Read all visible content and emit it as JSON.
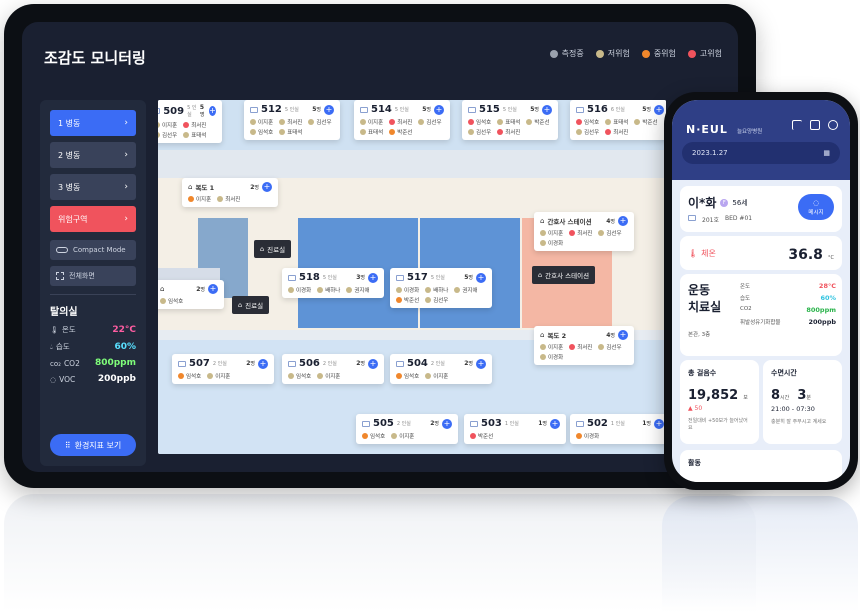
{
  "app": {
    "title": "조감도 모니터링"
  },
  "legend": [
    {
      "label": "측정중",
      "color": "#9aa1ad"
    },
    {
      "label": "저위험",
      "color": "#c8b98a"
    },
    {
      "label": "중위험",
      "color": "#f0872c"
    },
    {
      "label": "고위험",
      "color": "#f0535d"
    }
  ],
  "sidebar": {
    "wards": [
      {
        "label": "1 병동",
        "chev": "›"
      },
      {
        "label": "2 병동",
        "chev": "›"
      },
      {
        "label": "3 병동",
        "chev": "›"
      },
      {
        "label": "위험구역",
        "chev": "›"
      }
    ],
    "compact_label": "Compact Mode",
    "fullscreen_label": "전체화면",
    "room_name": "탈의실",
    "env": [
      {
        "label": "온도",
        "value": "22°C",
        "color": "#ff5da2"
      },
      {
        "label": "습도",
        "value": "60%",
        "color": "#59e0ff"
      },
      {
        "label": "CO2",
        "value": "800ppm",
        "color": "#7fff7a"
      },
      {
        "label": "VOC",
        "value": "200ppb",
        "color": "#ffffff"
      }
    ],
    "env_button": "환경지표 보기"
  },
  "floor": {
    "rooms": [
      {
        "num": "509",
        "beds": "5 인실",
        "count": "5",
        "patients": [
          {
            "name": "이지훈",
            "color": "#c8b98a"
          },
          {
            "name": "최서진",
            "color": "#f0535d"
          },
          {
            "name": "김선우",
            "color": "#c8b98a"
          },
          {
            "name": "표태석",
            "color": "#c8b98a"
          }
        ]
      },
      {
        "num": "512",
        "beds": "5 인실",
        "count": "5",
        "patients": [
          {
            "name": "이지훈",
            "color": "#c8b98a"
          },
          {
            "name": "최서진",
            "color": "#c8b98a"
          },
          {
            "name": "김선우",
            "color": "#c8b98a"
          },
          {
            "name": "임석호",
            "color": "#c8b98a"
          },
          {
            "name": "표태석",
            "color": "#c8b98a"
          }
        ]
      },
      {
        "num": "514",
        "beds": "5 인실",
        "count": "5",
        "patients": [
          {
            "name": "이지훈",
            "color": "#c8b98a"
          },
          {
            "name": "최서진",
            "color": "#f0535d"
          },
          {
            "name": "김선우",
            "color": "#c8b98a"
          },
          {
            "name": "표태석",
            "color": "#c8b98a"
          },
          {
            "name": "박준선",
            "color": "#f0872c"
          }
        ]
      },
      {
        "num": "515",
        "beds": "5 인실",
        "count": "5",
        "patients": [
          {
            "name": "임석호",
            "color": "#f0535d"
          },
          {
            "name": "표태석",
            "color": "#c8b98a"
          },
          {
            "name": "박준선",
            "color": "#c8b98a"
          },
          {
            "name": "김선우",
            "color": "#c8b98a"
          },
          {
            "name": "최서진",
            "color": "#f0535d"
          }
        ]
      },
      {
        "num": "516",
        "beds": "6 인실",
        "count": "5",
        "patients": [
          {
            "name": "임석호",
            "color": "#f0535d"
          },
          {
            "name": "표태석",
            "color": "#c8b98a"
          },
          {
            "name": "박준선",
            "color": "#c8b98a"
          },
          {
            "name": "김선우",
            "color": "#c8b98a"
          },
          {
            "name": "최서진",
            "color": "#f0535d"
          }
        ]
      },
      {
        "num": "518",
        "beds": "5 인실",
        "count": "3",
        "patients": [
          {
            "name": "이경화",
            "color": "#c8b98a"
          },
          {
            "name": "배하나",
            "color": "#c8b98a"
          },
          {
            "name": "권지애",
            "color": "#c8b98a"
          }
        ]
      },
      {
        "num": "517",
        "beds": "5 인실",
        "count": "5",
        "patients": [
          {
            "name": "이경화",
            "color": "#c8b98a"
          },
          {
            "name": "배하나",
            "color": "#c8b98a"
          },
          {
            "name": "권지애",
            "color": "#c8b98a"
          },
          {
            "name": "박준선",
            "color": "#f0872c"
          },
          {
            "name": "김선우",
            "color": "#c8b98a"
          }
        ]
      },
      {
        "num": "507",
        "beds": "2 인실",
        "count": "2",
        "patients": [
          {
            "name": "임석호",
            "color": "#f0872c"
          },
          {
            "name": "이지훈",
            "color": "#c8b98a"
          }
        ]
      },
      {
        "num": "506",
        "beds": "2 인실",
        "count": "2",
        "patients": [
          {
            "name": "임석호",
            "color": "#c8b98a"
          },
          {
            "name": "이지훈",
            "color": "#c8b98a"
          }
        ]
      },
      {
        "num": "504",
        "beds": "2 인실",
        "count": "2",
        "patients": [
          {
            "name": "임석호",
            "color": "#f0872c"
          },
          {
            "name": "이지훈",
            "color": "#c8b98a"
          }
        ]
      },
      {
        "num": "505",
        "beds": "2 인실",
        "count": "2",
        "patients": [
          {
            "name": "임석호",
            "color": "#f0872c"
          },
          {
            "name": "이지훈",
            "color": "#c8b98a"
          }
        ]
      },
      {
        "num": "503",
        "beds": "1 인실",
        "count": "1",
        "patients": [
          {
            "name": "박준선",
            "color": "#f0535d"
          }
        ]
      },
      {
        "num": "502",
        "beds": "1 인실",
        "count": "1",
        "patients": [
          {
            "name": "이경화",
            "color": "#f0872c"
          }
        ]
      }
    ],
    "corridors": [
      {
        "name": "복도 1",
        "count": "2",
        "patients": [
          {
            "name": "이지훈",
            "color": "#f0872c"
          },
          {
            "name": "최서진",
            "color": "#c8b98a"
          }
        ]
      },
      {
        "name": "간호사 스테이션",
        "count": "4",
        "patients": [
          {
            "name": "이지훈",
            "color": "#c8b98a"
          },
          {
            "name": "최서진",
            "color": "#f0535d"
          },
          {
            "name": "김선우",
            "color": "#c8b98a"
          },
          {
            "name": "이경화",
            "color": "#c8b98a"
          }
        ]
      },
      {
        "name": "복도 2",
        "count": "4",
        "patients": [
          {
            "name": "이지훈",
            "color": "#c8b98a"
          },
          {
            "name": "최서진",
            "color": "#f0535d"
          },
          {
            "name": "김선우",
            "color": "#c8b98a"
          },
          {
            "name": "이경화",
            "color": "#c8b98a"
          }
        ]
      },
      {
        "name": "",
        "count": "2",
        "patients": [
          {
            "name": "임석호",
            "color": "#c8b98a"
          }
        ]
      }
    ],
    "unit_count": "명",
    "labels": [
      {
        "text": "진료실"
      },
      {
        "text": "진료실"
      },
      {
        "text": "간호사 스테이션"
      }
    ]
  },
  "phone": {
    "logo": "N·EUL",
    "hospital": "늘요양병원",
    "date": "2023.1.27",
    "patient_name": "이*화",
    "gender": "F",
    "age": "56세",
    "room": "201호",
    "bed": "BED #01",
    "message_label": "메시지",
    "temp_label": "체온",
    "temp_value": "36.8",
    "temp_unit": "°C",
    "location_title": "운동\n치료실",
    "location_sub": "본관, 3층",
    "env": [
      {
        "label": "온도",
        "value": "28°C",
        "color": "#f0535d"
      },
      {
        "label": "습도",
        "value": "60%",
        "color": "#2fc3e0"
      },
      {
        "label": "CO2",
        "value": "800ppm",
        "color": "#29b34a"
      },
      {
        "label": "휘발성유기화합물",
        "value": "200ppb",
        "color": "#1a2031"
      }
    ],
    "steps_label": "총 걸음수",
    "steps_value": "19,852",
    "steps_unit": "보",
    "steps_delta": "▲ 50",
    "steps_note": "전일대비 +50보가 늘어났어요",
    "sleep_label": "수면시간",
    "sleep_h": "8",
    "sleep_h_unit": "시간",
    "sleep_m": "3",
    "sleep_m_unit": "분",
    "sleep_range": "21:00 - 07:30",
    "sleep_note": "충분히 잘 주무시고 계세요",
    "activity_label": "활동"
  }
}
